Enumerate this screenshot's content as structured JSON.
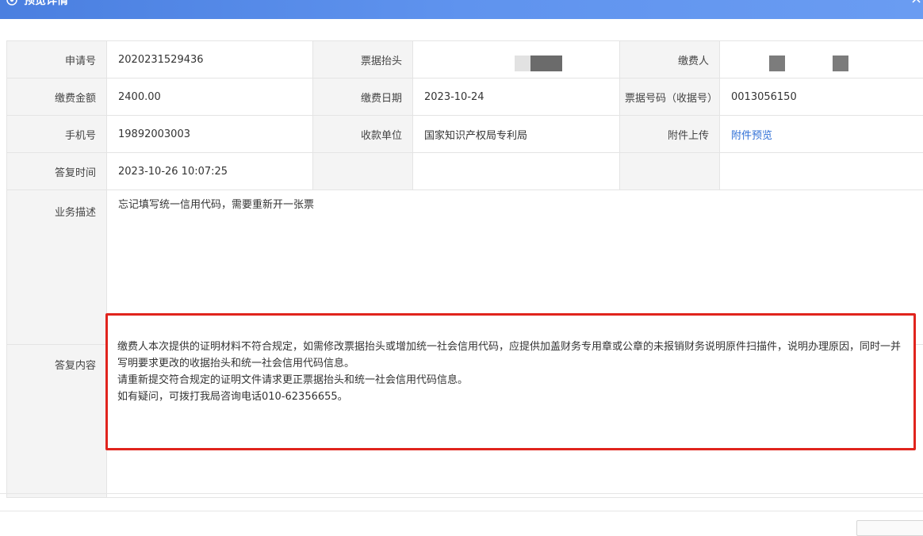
{
  "dialog": {
    "title": "预览详情",
    "close_label": "×"
  },
  "form": {
    "rows": [
      {
        "cells": [
          {
            "label": "申请号",
            "value": "2020231529436"
          },
          {
            "label": "票据抬头",
            "value": ""
          },
          {
            "label": "缴费人",
            "value": ""
          }
        ]
      },
      {
        "cells": [
          {
            "label": "缴费金额",
            "value": "2400.00"
          },
          {
            "label": "缴费日期",
            "value": "2023-10-24"
          },
          {
            "label": "票据号码（收据号）",
            "value": "0013056150"
          }
        ]
      },
      {
        "cells": [
          {
            "label": "手机号",
            "value": "19892003003"
          },
          {
            "label": "收款单位",
            "value": "国家知识产权局专利局"
          },
          {
            "label": "附件上传",
            "value": "附件预览"
          }
        ]
      },
      {
        "cells": [
          {
            "label": "答复时间",
            "value": "2023-10-26 10:07:25"
          },
          {
            "label": "",
            "value": ""
          },
          {
            "label": "",
            "value": ""
          }
        ]
      }
    ],
    "business_description": {
      "label": "业务描述",
      "value": "忘记填写统一信用代码，需要重新开一张票"
    },
    "reply": {
      "label": "答复内容",
      "lines": [
        "缴费人本次提供的证明材料不符合规定，如需修改票据抬头或增加统一社会信用代码，应提供加盖财务专用章或公章的未报销财务说明原件扫描件，说明办理原因，同时一并写明要求更改的收据抬头和统一社会信用代码信息。",
        "请重新提交符合规定的证明文件请求更正票据抬头和统一社会信用代码信息。",
        "如有疑问，可拨打我局咨询电话010-62356655。"
      ]
    }
  },
  "colors": {
    "title_bar": "#5f93ee",
    "highlight_border": "#e0241d",
    "link": "#2f6fd6",
    "label_bg": "#f4f4f4"
  },
  "icons": {
    "title": "eye-icon",
    "close": "close-icon",
    "resize": "resize-handle-icon"
  }
}
